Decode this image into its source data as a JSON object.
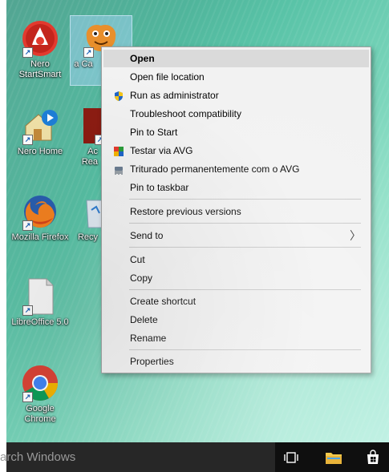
{
  "desktop": {
    "icons": [
      {
        "label": "Nero StartSmart",
        "icon": "nero-icon"
      },
      {
        "label": "Nero Home",
        "icon": "nero-home-icon"
      },
      {
        "label": "Mozilla Firefox",
        "icon": "firefox-icon"
      },
      {
        "label": "LibreOffice 5.0",
        "icon": "libreoffice-icon"
      },
      {
        "label": "Google Chrome",
        "icon": "chrome-icon"
      },
      {
        "label": "a Ca",
        "icon": "mascot-icon"
      },
      {
        "label": "Ac Rea",
        "icon": "acrobat-icon"
      },
      {
        "label": "Recy",
        "icon": "recycle-bin-icon"
      }
    ]
  },
  "context_menu": {
    "items": [
      {
        "label": "Open",
        "bold": true
      },
      {
        "label": "Open file location"
      },
      {
        "label": "Run as administrator",
        "icon": "uac-shield-icon"
      },
      {
        "label": "Troubleshoot compatibility"
      },
      {
        "label": "Pin to Start"
      },
      {
        "label": "Testar via  AVG",
        "icon": "avg-icon"
      },
      {
        "label": "Triturado permanentemente com o AVG",
        "icon": "shredder-icon"
      },
      {
        "label": "Pin to taskbar"
      },
      {
        "label": "Restore previous versions"
      },
      {
        "label": "Send to",
        "submenu": true
      },
      {
        "label": "Cut"
      },
      {
        "label": "Copy"
      },
      {
        "label": "Create shortcut"
      },
      {
        "label": "Delete"
      },
      {
        "label": "Rename"
      },
      {
        "label": "Properties"
      }
    ],
    "chevron": "〉"
  },
  "taskbar": {
    "search_text": "arch Windows"
  },
  "colors": {
    "menu_bg": "#f2f2f2",
    "taskbar": "#0f0f0f"
  }
}
